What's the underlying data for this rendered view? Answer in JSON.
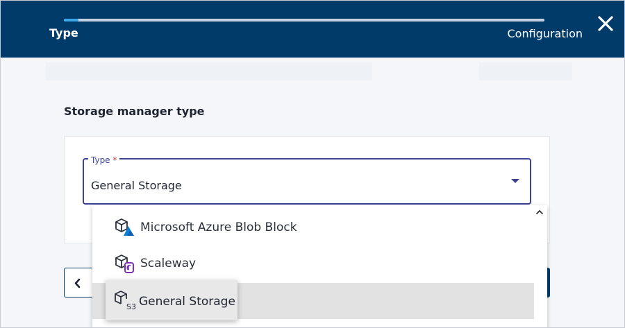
{
  "stepper": {
    "steps": [
      {
        "label": "Type",
        "active": true
      },
      {
        "label": "Configuration",
        "active": false
      }
    ],
    "progress": 0.03
  },
  "section": {
    "title": "Storage manager type"
  },
  "type_field": {
    "label": "Type",
    "required_mark": "*",
    "value": "General Storage"
  },
  "dropdown": {
    "options": [
      {
        "label": "Microsoft Azure Blob Block",
        "icon": "azure-storage-icon"
      },
      {
        "label": "Scaleway",
        "icon": "scaleway-storage-icon"
      },
      {
        "label": "General Storage",
        "icon": "s3-storage-icon",
        "selected": true
      }
    ],
    "s3_badge": "S3"
  },
  "colors": {
    "header": "#003b6a",
    "accent": "#3b4293",
    "progress": "#3aa7e8",
    "required": "#d4242b",
    "scaleway": "#7a2fb6",
    "azure": "#0a7fd6"
  }
}
